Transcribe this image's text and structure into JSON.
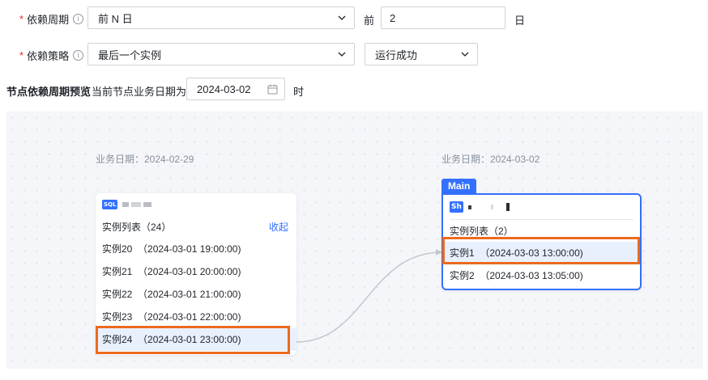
{
  "form": {
    "period": {
      "required_mark": "*",
      "label": "依赖周期",
      "info_icon": "ⓘ",
      "select_value": "前 N 日",
      "prefix": "前",
      "n_value": "2",
      "suffix": "日"
    },
    "strategy": {
      "required_mark": "*",
      "label": "依赖策略",
      "info_icon": "ⓘ",
      "select_value": "最后一个实例",
      "status_value": "运行成功"
    },
    "preview": {
      "title": "节点依赖周期预览",
      "desc": "当前节点业务日期为",
      "date_value": "2024-03-02",
      "suffix": "时"
    }
  },
  "graph": {
    "upstream": {
      "date_label": "业务日期：2024-02-29",
      "type_icon": "SQL",
      "list_header": "实例列表（24）",
      "collapse": "收起",
      "instances": [
        "实例20  （2024-03-01 19:00:00)",
        "实例21  （2024-03-01 20:00:00)",
        "实例22  （2024-03-01 21:00:00)",
        "实例23  （2024-03-01 22:00:00)",
        "实例24  （2024-03-01 23:00:00)"
      ]
    },
    "main": {
      "date_label": "业务日期：2024-03-02",
      "tag": "Main",
      "type_icon": "Sh",
      "list_header": "实例列表（2）",
      "instances": [
        "实例1  （2024-03-03 13:00:00)",
        "实例2  （2024-03-03 13:05:00)"
      ]
    }
  },
  "colors": {
    "accent": "#3370ff",
    "highlight": "#ec6a1f",
    "required": "#f5222d",
    "selected_bg": "#e8f0fe"
  }
}
